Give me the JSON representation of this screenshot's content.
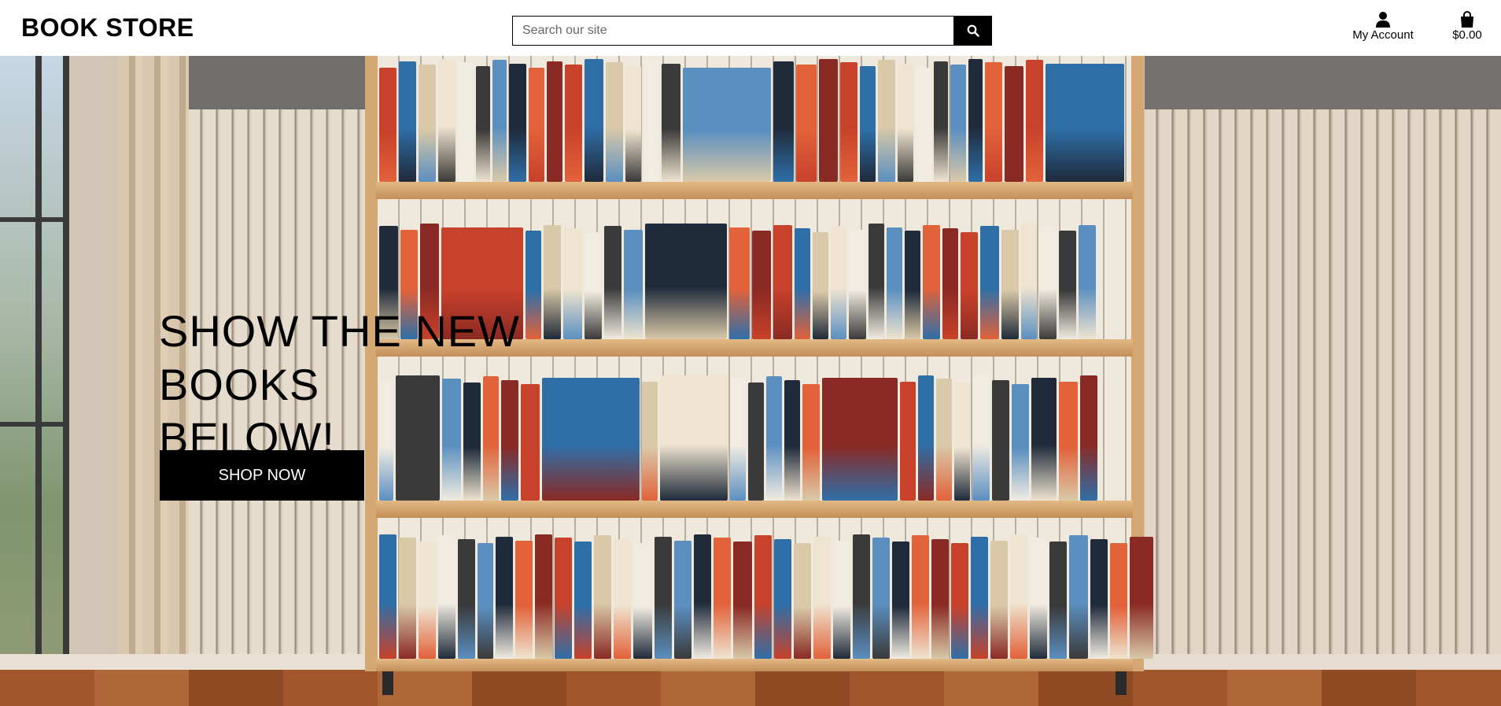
{
  "header": {
    "brand": "BOOK STORE",
    "search": {
      "placeholder": "Search our site",
      "value": "",
      "button_icon": "search-icon"
    },
    "account": {
      "label": "My Account",
      "icon": "user-icon"
    },
    "cart": {
      "total": "$0.00",
      "icon": "shopping-bag-icon"
    }
  },
  "hero": {
    "title_line1": "SHOW THE NEW BOOKS",
    "title_line2": "BELOW!",
    "cta_label": "SHOP NOW",
    "image": "bookshelf-photo"
  },
  "colors": {
    "primary": "#000000",
    "on_primary": "#ffffff",
    "header_bg": "#ffffff"
  }
}
